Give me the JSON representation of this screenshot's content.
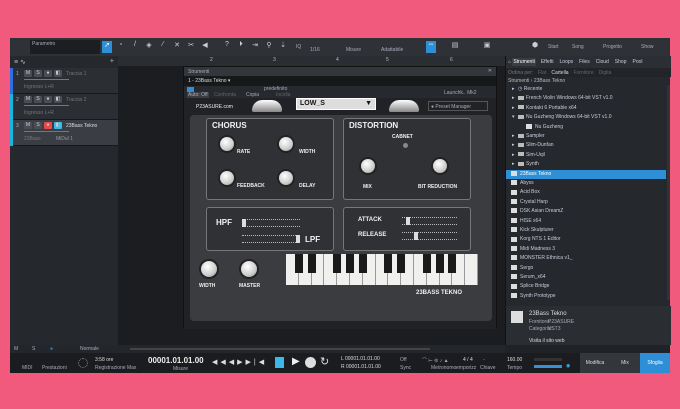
{
  "toolbar": {
    "parameter_label": "Parametro",
    "quantize": "1/16",
    "timebase": "Misure",
    "snap": "Adattabile",
    "start": "Start",
    "song": "Song",
    "project": "Progetto",
    "show": "Show",
    "iq": "IQ"
  },
  "tracks": [
    {
      "num": "1",
      "name": "Traccia 1",
      "input": "Ingresso L+R",
      "color": "#2e6ee0"
    },
    {
      "num": "2",
      "name": "Traccia 2",
      "input": "Ingresso L+R",
      "color": "#19b5e0"
    },
    {
      "num": "3",
      "name": "23Bass Tekno",
      "input": "23Bass",
      "midi": "MiDul 1",
      "color": "#19b5e0"
    }
  ],
  "ruler": [
    "2",
    "3",
    "4",
    "5",
    "6"
  ],
  "plugin_window": {
    "title": "Strumenti",
    "instance": "1 - 23Bass Tekno",
    "preset": "predefinito",
    "auto": "Auto: Off",
    "compare": "Confronta",
    "copy": "Copia",
    "paste": "Incolla",
    "launch": "Launchk.. Mk2"
  },
  "plugin": {
    "site": "P23ASURE.com",
    "preset": "LOW_S",
    "preset_manager": "Preset Manager",
    "chorus": "CHORUS",
    "rate": "RATE",
    "width": "WIDTH",
    "feedback": "FEEDBACK",
    "delay": "DELAY",
    "distortion": "DISTORTION",
    "cabinet": "CABNET",
    "mix": "MIX",
    "bit_reduction": "BIT REDUCTION",
    "hpf": "HPF",
    "lpf": "LPF",
    "attack": "ATTACK",
    "release": "RELEASE",
    "width2": "WIDTH",
    "master": "MASTER",
    "brand": "23BASS TEKNO"
  },
  "browser": {
    "tabs": [
      "Strumenti",
      "Effetti",
      "Loops",
      "Files",
      "Cloud",
      "Shop",
      "Pool"
    ],
    "sort_label": "Ordina per:",
    "sort_options": [
      "Flat",
      "Cartella",
      "Fornitore",
      "Digita"
    ],
    "breadcrumb": [
      "Strumenti",
      "23Bass Tekno"
    ],
    "items": [
      {
        "label": "Recente",
        "type": "recent"
      },
      {
        "label": "French Violin Windows 64-bit VST v1.0",
        "type": "folder"
      },
      {
        "label": "Kontakt 6 Portable x64",
        "type": "folder"
      },
      {
        "label": "Nu Guzheng Windows 64-bit VST v1.0",
        "type": "folder-open"
      },
      {
        "label": "Nu Guzheng",
        "type": "plugin-sub"
      },
      {
        "label": "Sampler",
        "type": "folder"
      },
      {
        "label": "Slim-Dunfan",
        "type": "folder"
      },
      {
        "label": "Sim-Uqil",
        "type": "folder"
      },
      {
        "label": "Synth",
        "type": "folder"
      },
      {
        "label": "23Bass Tekno",
        "type": "plugin",
        "selected": true
      },
      {
        "label": "Abyss",
        "type": "plugin"
      },
      {
        "label": "Acid Box",
        "type": "plugin"
      },
      {
        "label": "Crystal Harp",
        "type": "plugin"
      },
      {
        "label": "DSK Asian DreamZ",
        "type": "plugin"
      },
      {
        "label": "HISE x64",
        "type": "plugin"
      },
      {
        "label": "Kick Skulpturer",
        "type": "plugin"
      },
      {
        "label": "Korg NTS 1 Editor",
        "type": "plugin"
      },
      {
        "label": "Midi Madness 3",
        "type": "plugin"
      },
      {
        "label": "MONSTER Ethnica v1_",
        "type": "plugin"
      },
      {
        "label": "Sergo",
        "type": "plugin"
      },
      {
        "label": "Serum_x64",
        "type": "plugin"
      },
      {
        "label": "Splice Bridge",
        "type": "plugin"
      },
      {
        "label": "Synth Prototype",
        "type": "plugin"
      }
    ],
    "info": {
      "name": "23Bass Tekno",
      "vendor_label": "Fornitore:",
      "vendor": "P23ASURE",
      "category_label": "Categoria:",
      "category": "VST3",
      "website": "Visita il sito web"
    }
  },
  "footer": {
    "mode": "Normale"
  },
  "transport": {
    "midi": "MIDI",
    "performance": "Prestazioni",
    "rec_time": "3:58 ore",
    "rec_label": "Registrazione Max",
    "position": "00001.01.01.00",
    "position_unit": "Misure",
    "left": "00001.01.01.00",
    "right": "00001.01.01.00",
    "sync": "Sync",
    "sync_top": "Off",
    "metronome": "Metronomo",
    "signature": "4 / 4",
    "signature_label": "emporizz",
    "key": "-",
    "key_label": "Chiave",
    "tempo": "160.00",
    "tempo_label": "Tempo",
    "modify": "Modifica",
    "mix": "Mix",
    "browse": "Sfoglia"
  },
  "colors": {
    "accent": "#2e8fd6",
    "background": "#f15a7c",
    "record": "#e84a4a"
  }
}
